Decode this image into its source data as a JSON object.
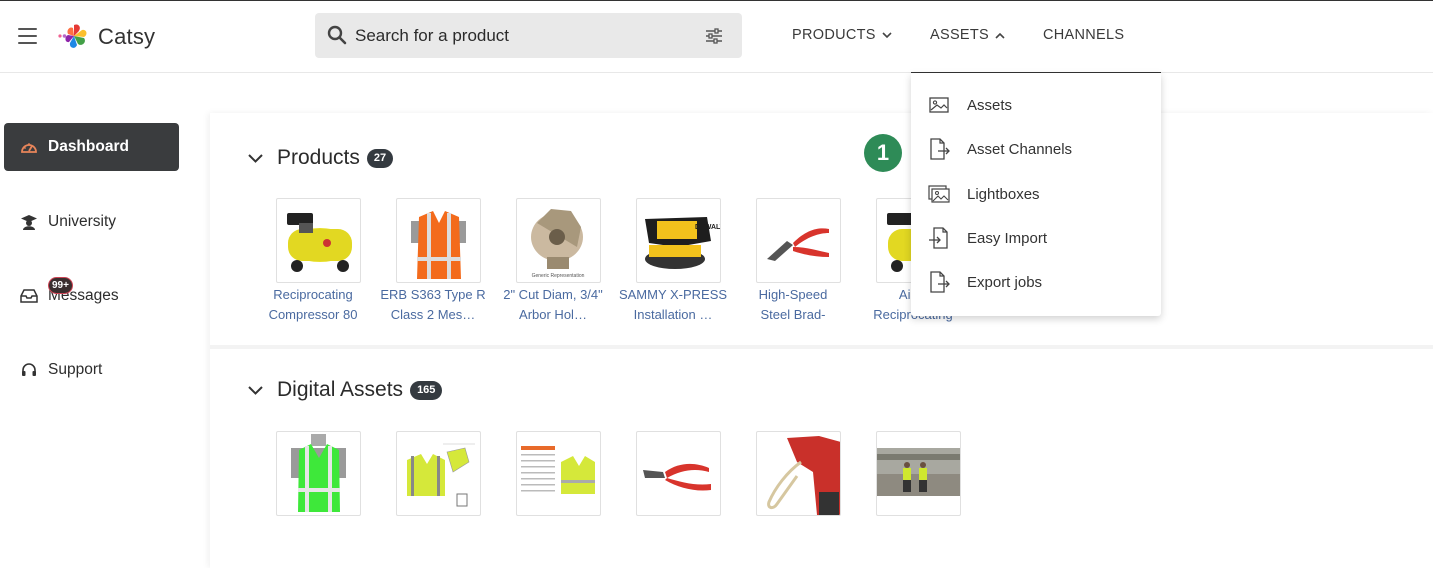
{
  "header": {
    "brand": "Catsy",
    "search_placeholder": "Search for a product",
    "nav": [
      {
        "label": "PRODUCTS"
      },
      {
        "label": "ASSETS"
      },
      {
        "label": "CHANNELS"
      }
    ]
  },
  "sidebar": {
    "items": [
      {
        "label": "Dashboard",
        "icon": "gauge-icon"
      },
      {
        "label": "University",
        "icon": "graduation-cap-icon"
      },
      {
        "label": "Messages",
        "icon": "inbox-icon",
        "badge": "99+"
      },
      {
        "label": "Support",
        "icon": "headset-icon"
      }
    ]
  },
  "sections": {
    "products": {
      "title": "Products",
      "count": "27",
      "items": [
        {
          "line1": "Reciprocating",
          "line2": "Compressor 80"
        },
        {
          "line1": "ERB S363 Type R",
          "line2": "Class 2 Mes…"
        },
        {
          "line1": "2\" Cut Diam, 3/4\"",
          "line2": "Arbor Hol…"
        },
        {
          "line1": "SAMMY X-PRESS",
          "line2": "Installation …"
        },
        {
          "line1": "High-Speed",
          "line2": "Steel Brad-"
        },
        {
          "line1": "AirSt",
          "line2": "Reciprocating"
        }
      ]
    },
    "digital_assets": {
      "title": "Digital Assets",
      "count": "165"
    }
  },
  "assets_menu": {
    "items": [
      {
        "label": "Assets",
        "icon": "image-icon"
      },
      {
        "label": "Asset Channels",
        "icon": "file-export-icon"
      },
      {
        "label": "Lightboxes",
        "icon": "images-icon"
      },
      {
        "label": "Easy Import",
        "icon": "file-import-icon"
      },
      {
        "label": "Export jobs",
        "icon": "file-export-icon"
      }
    ]
  },
  "step_marker": "1",
  "colors": {
    "sidebar_active_bg": "#3a3c3e",
    "badge_bg": "#343a40",
    "link": "#4a6aa0",
    "step_marker": "#2e8b57",
    "dashboard_icon": "#e8855a"
  }
}
